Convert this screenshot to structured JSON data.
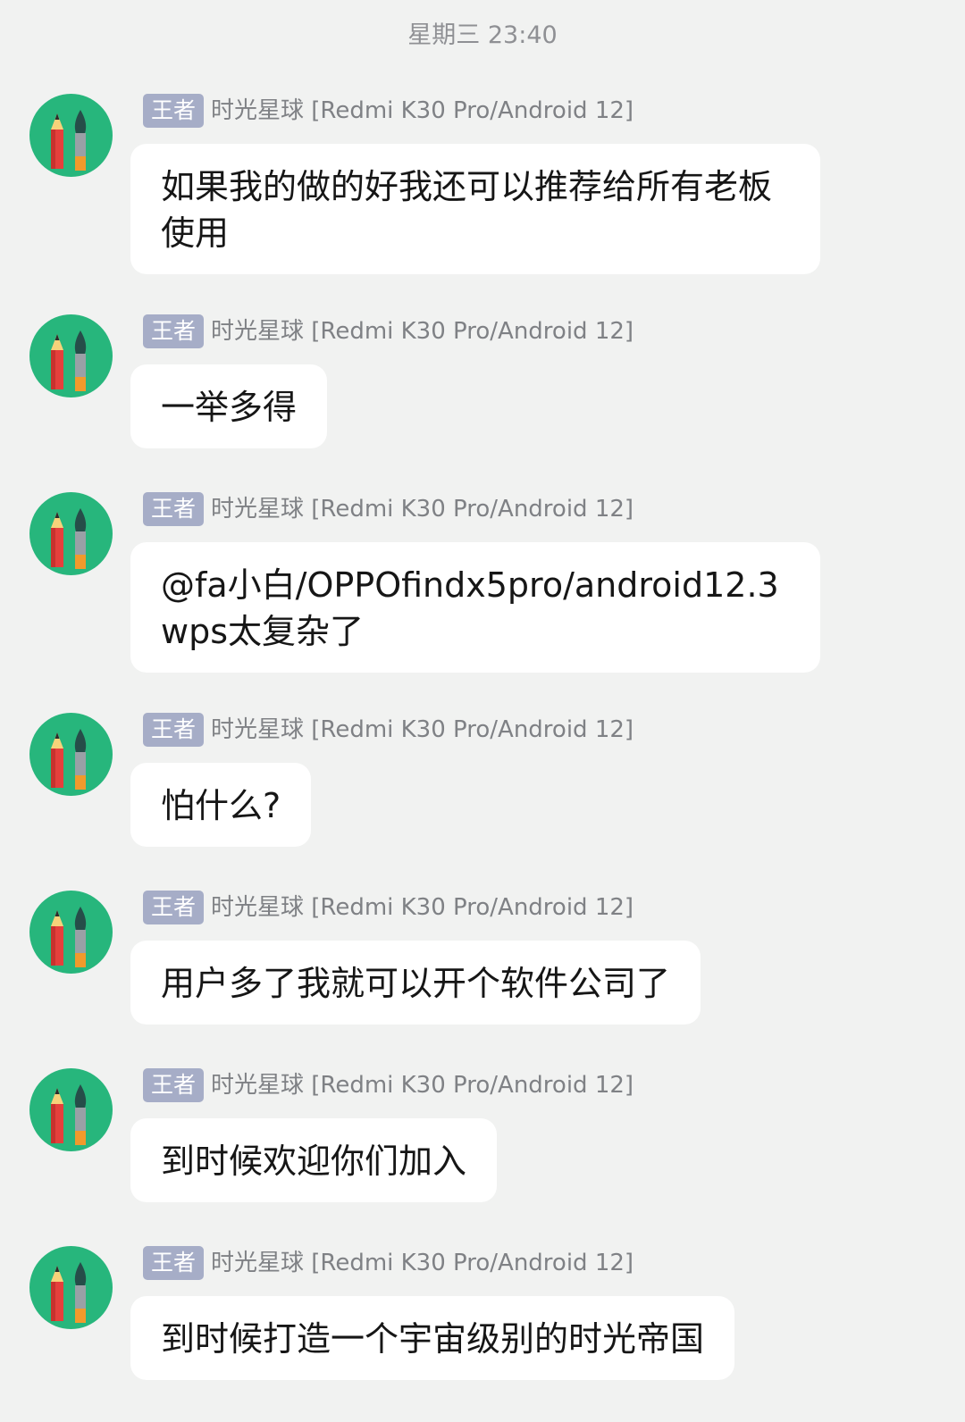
{
  "chat": {
    "timestamp": "星期三 23:40",
    "badge_label": "王者",
    "sender_label": "时光星球 [Redmi K30 Pro/Android 12]",
    "messages": [
      {
        "text": "如果我的做的好我还可以推荐给所有老板\n使用"
      },
      {
        "text": "一举多得"
      },
      {
        "text": "@fa小白/OPPOfindx5pro/android12.3\nwps太复杂了"
      },
      {
        "text": "怕什么?"
      },
      {
        "text": "用户多了我就可以开个软件公司了"
      },
      {
        "text": "到时候欢迎你们加入"
      },
      {
        "text": "到时候打造一个宇宙级别的时光帝国"
      }
    ]
  },
  "colors": {
    "background": "#f1f2f1",
    "avatar_bg": "#27b67c",
    "badge_bg": "#a6adc7",
    "bubble_bg": "#ffffff"
  },
  "icons": {
    "avatar": "pencil-and-brush-icon"
  }
}
